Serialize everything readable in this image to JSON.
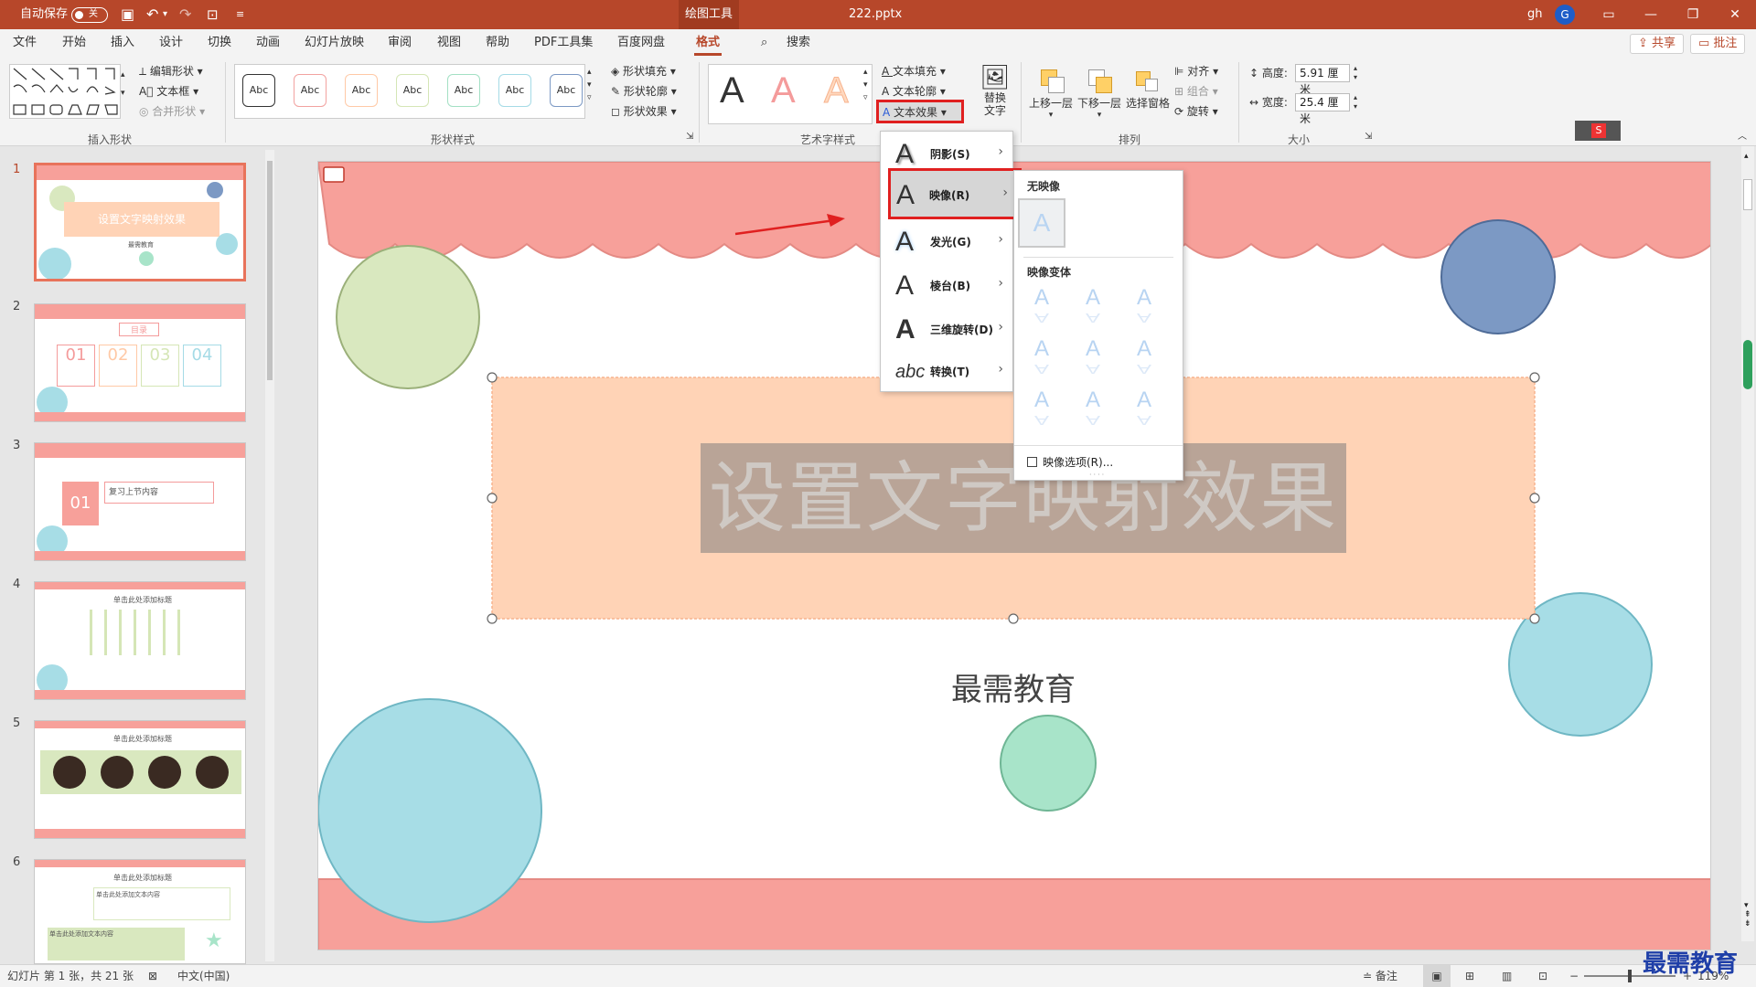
{
  "titlebar": {
    "autosave_label": "自动保存",
    "autosave_state": "关",
    "context_tab": "绘图工具",
    "filename": "222.pptx",
    "user": "gh",
    "avatar": "G"
  },
  "menu": {
    "tabs": [
      "文件",
      "开始",
      "插入",
      "设计",
      "切换",
      "动画",
      "幻灯片放映",
      "审阅",
      "视图",
      "帮助",
      "PDF工具集",
      "百度网盘",
      "格式"
    ],
    "active_tab": "格式",
    "search": "搜索",
    "share": "共享",
    "comment": "批注"
  },
  "ribbon": {
    "insert_shapes": {
      "label": "插入形状",
      "edit_shape": "编辑形状",
      "textbox": "文本框",
      "merge_shapes": "合并形状"
    },
    "shape_styles": {
      "label": "形状样式",
      "samples": [
        "Abc",
        "Abc",
        "Abc",
        "Abc",
        "Abc",
        "Abc",
        "Abc"
      ],
      "fill": "形状填充",
      "outline": "形状轮廓",
      "effects": "形状效果"
    },
    "wordart": {
      "label": "艺术字样式",
      "samples": [
        "A",
        "A",
        "A"
      ],
      "text_fill": "文本填充",
      "text_outline": "文本轮廓",
      "text_effects": "文本效果"
    },
    "alt_text": "替换文字",
    "arrange": {
      "label": "排列",
      "bring_forward": "上移一层",
      "send_backward": "下移一层",
      "selection_pane": "选择窗格",
      "align": "对齐",
      "group": "组合",
      "rotate": "旋转"
    },
    "size": {
      "label": "大小",
      "height_label": "高度:",
      "height_value": "5.91 厘米",
      "width_label": "宽度:",
      "width_value": "25.4 厘米"
    }
  },
  "effects_menu": {
    "items": [
      {
        "label": "阴影(S)"
      },
      {
        "label": "映像(R)"
      },
      {
        "label": "发光(G)"
      },
      {
        "label": "棱台(B)"
      },
      {
        "label": "三维旋转(D)"
      },
      {
        "label": "转换(T)"
      }
    ]
  },
  "reflection_menu": {
    "none_title": "无映像",
    "variants_title": "映像变体",
    "options": "映像选项(R)...",
    "glyph": "A"
  },
  "thumbnails": {
    "numbers": [
      "1",
      "2",
      "3",
      "4",
      "5",
      "6"
    ],
    "t1_title": "设置文字映射效果",
    "t1_sub": "最需教育",
    "t2_title": "目录",
    "t2_nums": [
      "01",
      "02",
      "03",
      "04"
    ],
    "t3_num": "01",
    "t3_text": "复习上节内容",
    "t4_title": "单击此处添加标题",
    "t5_title": "单击此处添加标题",
    "t6_title": "单击此处添加标题",
    "t6_text": "单击此处添加文本内容"
  },
  "slide": {
    "title": "设置文字映射效果",
    "subtitle": "最需教育"
  },
  "status": {
    "slide_info": "幻灯片 第 1 张，共 21 张",
    "language": "中文(中国)",
    "notes": "备注",
    "zoom": "119%"
  },
  "watermark": "最需教育",
  "colors": {
    "accent": "#b7472a",
    "scallop": "#f7a09a",
    "peach": "#ffd3b6",
    "green_circle": "#d9e8bf",
    "blue_circle": "#7c99c4",
    "cyan_circle": "#a7dde6",
    "mint_circle": "#a8e4c9",
    "highlight_red": "#e02020"
  }
}
